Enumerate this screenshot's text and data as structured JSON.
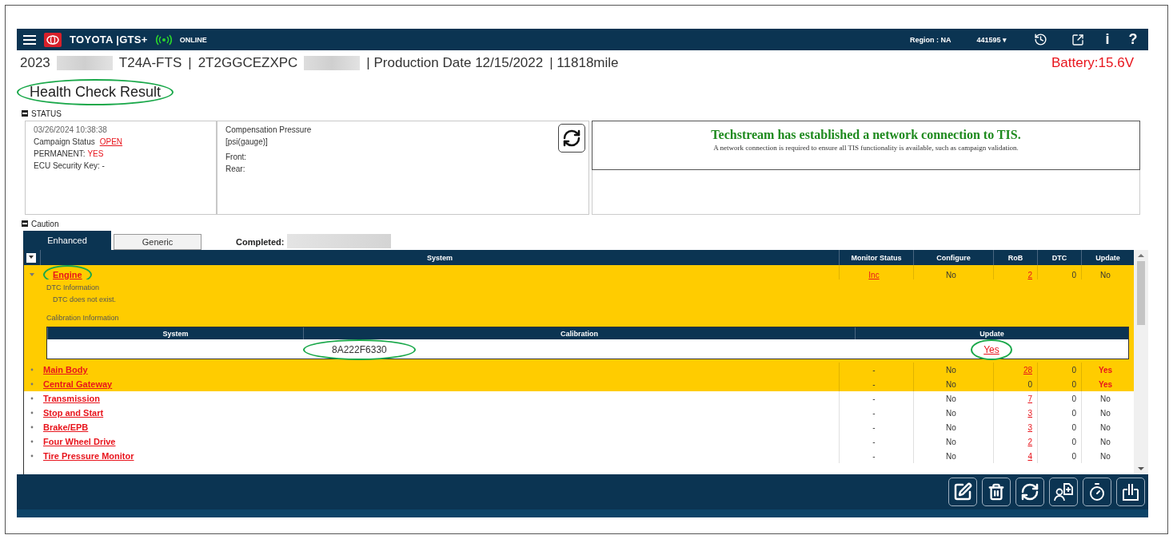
{
  "top_bar": {
    "brand": "TOYOTA |GTS+",
    "connection": "ONLINE",
    "online": true,
    "region": "Region : NA",
    "account": "441595 ▾",
    "info_glyph": "i",
    "help_glyph": "?"
  },
  "vehicle": {
    "year": "2023",
    "model": "T24A-FTS",
    "separator": "|",
    "vin": "2T2GGCEZXPC",
    "production": "| Production Date 12/15/2022",
    "mileage": "| 11818mile",
    "battery": "Battery:15.6V"
  },
  "page_title": {
    "text": "Health Check Result",
    "circled": true
  },
  "status": {
    "heading": "STATUS",
    "expanded": true,
    "timestamp": "03/26/2024 10:38:38",
    "campaign_label": "Campaign Status",
    "campaign_value": "OPEN",
    "permanent_label": "PERMANENT:",
    "permanent_value": "YES",
    "ecu_key": "ECU Security Key: -",
    "pressure_title": "Compensation Pressure",
    "pressure_unit": "[psi(gauge)]",
    "front": "Front:",
    "rear": "Rear:",
    "message_title": "Techstream has established a network connection to TIS.",
    "message_body": "A network connection is required to ensure all TIS functionality is available, such as campaign validation."
  },
  "caution": {
    "heading": "Caution",
    "expanded": true,
    "tabs": [
      {
        "label": "Enhanced",
        "selected": true
      },
      {
        "label": "Generic",
        "selected": false
      }
    ],
    "completed_label": "Completed:",
    "columns": [
      "System",
      "Monitor Status",
      "Configure",
      "RoB",
      "DTC",
      "Update"
    ],
    "rows": [
      {
        "system": "Engine",
        "highlighted": true,
        "expanded": true,
        "circled": true,
        "monitor": "Inc",
        "monitor_alert": true,
        "configure": "No",
        "rob": "2",
        "rob_alert": true,
        "dtc": "0",
        "update": "No",
        "update_alert": false,
        "detail": {
          "dtc_label": "DTC Information",
          "dtc_text": "DTC does not exist.",
          "calibration_label": "Calibration Information",
          "columns": [
            "System",
            "Calibration",
            "Update"
          ],
          "calibration": "8A222F6330",
          "calibration_circled": true,
          "update": "Yes",
          "update_circled": true
        }
      },
      {
        "system": "Main Body",
        "highlighted": true,
        "expanded": false,
        "monitor": "-",
        "monitor_alert": false,
        "configure": "No",
        "rob": "28",
        "rob_alert": true,
        "dtc": "0",
        "update": "Yes",
        "update_alert": true
      },
      {
        "system": "Central Gateway",
        "highlighted": true,
        "expanded": false,
        "monitor": "-",
        "monitor_alert": false,
        "configure": "No",
        "rob": "0",
        "rob_alert": false,
        "dtc": "0",
        "update": "Yes",
        "update_alert": true
      },
      {
        "system": "Transmission",
        "highlighted": false,
        "expanded": false,
        "monitor": "-",
        "monitor_alert": false,
        "configure": "No",
        "rob": "7",
        "rob_alert": true,
        "dtc": "0",
        "update": "No",
        "update_alert": false
      },
      {
        "system": "Stop and Start",
        "highlighted": false,
        "expanded": false,
        "monitor": "-",
        "monitor_alert": false,
        "configure": "No",
        "rob": "3",
        "rob_alert": true,
        "dtc": "0",
        "update": "No",
        "update_alert": false
      },
      {
        "system": "Brake/EPB",
        "highlighted": false,
        "expanded": false,
        "monitor": "-",
        "monitor_alert": false,
        "configure": "No",
        "rob": "3",
        "rob_alert": true,
        "dtc": "0",
        "update": "No",
        "update_alert": false
      },
      {
        "system": "Four Wheel Drive",
        "highlighted": false,
        "expanded": false,
        "monitor": "-",
        "monitor_alert": false,
        "configure": "No",
        "rob": "2",
        "rob_alert": true,
        "dtc": "0",
        "update": "No",
        "update_alert": false
      },
      {
        "system": "Tire Pressure Monitor",
        "highlighted": false,
        "expanded": false,
        "monitor": "-",
        "monitor_alert": false,
        "configure": "No",
        "rob": "4",
        "rob_alert": true,
        "dtc": "0",
        "update": "No",
        "update_alert": false
      }
    ]
  }
}
